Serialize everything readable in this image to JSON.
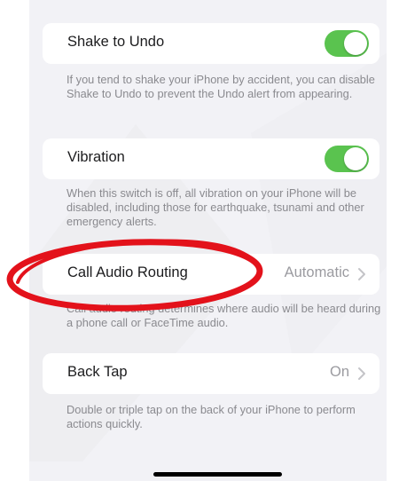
{
  "settings": {
    "shake_to_undo": {
      "label": "Shake to Undo",
      "toggle_on": true,
      "footer": "If you tend to shake your iPhone by accident, you can disable Shake to Undo to prevent the Undo alert from appearing."
    },
    "vibration": {
      "label": "Vibration",
      "toggle_on": true,
      "footer": "When this switch is off, all vibration on your iPhone will be disabled, including those for earthquake, tsunami and other emergency alerts."
    },
    "call_audio_routing": {
      "label": "Call Audio Routing",
      "value": "Automatic",
      "footer": "Call audio routing determines where audio will be heard during a phone call or FaceTime audio."
    },
    "back_tap": {
      "label": "Back Tap",
      "value": "On",
      "footer": "Double or triple tap on the back of your iPhone to perform actions quickly."
    }
  },
  "colors": {
    "toggle_on": "#5ac34f",
    "annotation_circle": "#e3121b",
    "background": "#f2f2f6"
  }
}
